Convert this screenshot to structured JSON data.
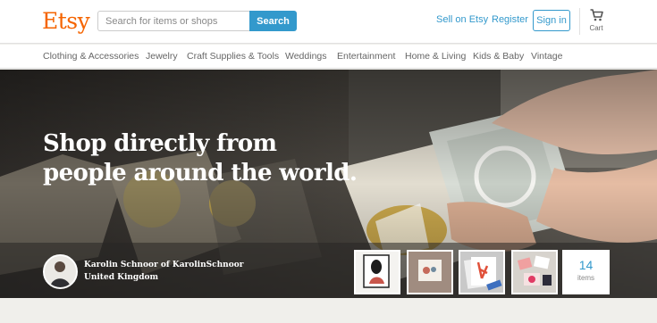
{
  "brand": {
    "logo": "Etsy",
    "accent": "#f56400",
    "link_color": "#3399cc"
  },
  "search": {
    "placeholder": "Search for items or shops",
    "button_label": "Search"
  },
  "header_links": {
    "sell": "Sell on Etsy",
    "register": "Register",
    "sign_in": "Sign in",
    "cart": "Cart",
    "cart_icon": "cart-icon"
  },
  "nav": {
    "items": [
      "Clothing & Accessories",
      "Jewelry",
      "Craft Supplies & Tools",
      "Weddings",
      "Entertainment",
      "Home & Living",
      "Kids & Baby",
      "Vintage"
    ]
  },
  "hero": {
    "title": "Shop directly from people around the world.",
    "seller": {
      "name": "Karolin Schnoor of KarolinSchnoor",
      "country": "United Kingdom"
    },
    "listing_count": "14",
    "listing_label": "items"
  }
}
